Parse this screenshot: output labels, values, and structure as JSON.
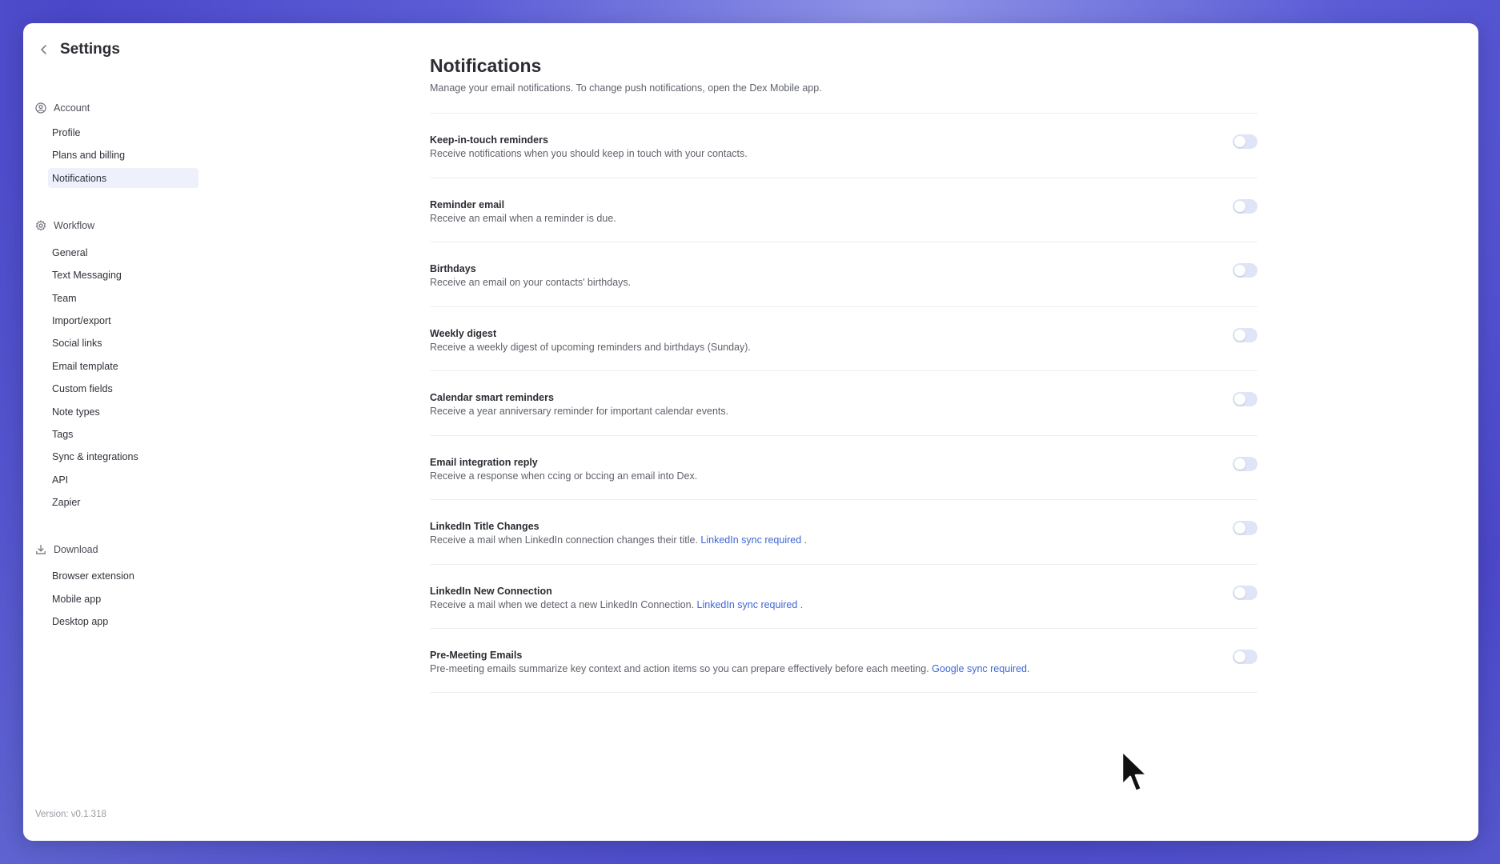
{
  "sidebar": {
    "title": "Settings",
    "sections": [
      {
        "label": "Account",
        "icon": "user-circle-icon",
        "items": [
          "Profile",
          "Plans and billing",
          "Notifications"
        ]
      },
      {
        "label": "Workflow",
        "icon": "gear-icon",
        "items": [
          "General",
          "Text Messaging",
          "Team",
          "Import/export",
          "Social links",
          "Email template",
          "Custom fields",
          "Note types",
          "Tags",
          "Sync & integrations",
          "API",
          "Zapier"
        ]
      },
      {
        "label": "Download",
        "icon": "download-icon",
        "items": [
          "Browser extension",
          "Mobile app",
          "Desktop app"
        ]
      }
    ],
    "active_item": "Notifications",
    "version": "Version: v0.1.318"
  },
  "main": {
    "title": "Notifications",
    "subtitle": "Manage your email notifications. To change push notifications, open the Dex Mobile app.",
    "rows": [
      {
        "title": "Keep-in-touch reminders",
        "desc": "Receive notifications when you should keep in touch with your contacts.",
        "link": "",
        "suffix": "",
        "enabled": false
      },
      {
        "title": "Reminder email",
        "desc": "Receive an email when a reminder is due.",
        "link": "",
        "suffix": "",
        "enabled": false
      },
      {
        "title": "Birthdays",
        "desc": "Receive an email on your contacts' birthdays.",
        "link": "",
        "suffix": "",
        "enabled": false
      },
      {
        "title": "Weekly digest",
        "desc": "Receive a weekly digest of upcoming reminders and birthdays (Sunday).",
        "link": "",
        "suffix": "",
        "enabled": false
      },
      {
        "title": "Calendar smart reminders",
        "desc": "Receive a year anniversary reminder for important calendar events.",
        "link": "",
        "suffix": "",
        "enabled": false
      },
      {
        "title": "Email integration reply",
        "desc": "Receive a response when ccing or bccing an email into Dex.",
        "link": "",
        "suffix": "",
        "enabled": false
      },
      {
        "title": "LinkedIn Title Changes",
        "desc": "Receive a mail when LinkedIn connection changes their title. ",
        "link": "LinkedIn sync required",
        "suffix": " .",
        "enabled": false
      },
      {
        "title": "LinkedIn New Connection",
        "desc": "Receive a mail when we detect a new LinkedIn Connection. ",
        "link": "LinkedIn sync required",
        "suffix": " .",
        "enabled": false
      },
      {
        "title": "Pre-Meeting Emails",
        "desc": "Pre-meeting emails summarize key context and action items so you can prepare effectively before each meeting. ",
        "link": "Google sync required",
        "suffix": ".",
        "enabled": false
      }
    ]
  },
  "colors": {
    "accent": "#3e67d6",
    "toggle_off": "#dfe5f6",
    "active_bg": "#eef1fb"
  }
}
